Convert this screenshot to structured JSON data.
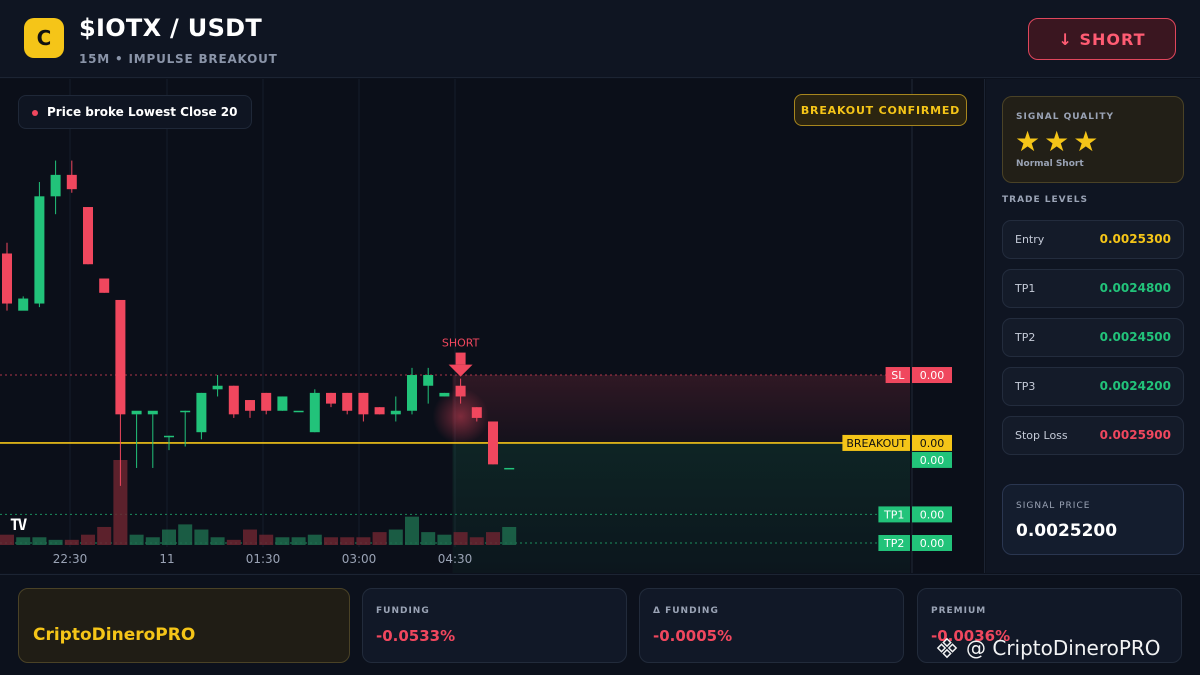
{
  "header": {
    "logo_letter": "C",
    "title": "$IOTX / USDT",
    "subtitle": "15M • IMPULSE BREAKOUT",
    "action_label": "↓ SHORT"
  },
  "chart": {
    "info_text": "Price broke Lowest Close 20",
    "confirm_badge": "BREAKOUT CONFIRMED",
    "signal_marker": "SHORT",
    "watermark_logo": "TV",
    "time_labels": [
      "22:30",
      "11",
      "01:30",
      "03:00",
      "04:30"
    ],
    "price_tags": [
      {
        "label": "SL",
        "value": "0.00",
        "color": "#f0475e"
      },
      {
        "label": "BREAKOUT",
        "value": "0.00",
        "color": "#f5c518"
      },
      {
        "label": "",
        "value": "0.00",
        "color": "#22c37a"
      },
      {
        "label": "TP1",
        "value": "0.00",
        "color": "#22c37a"
      },
      {
        "label": "TP2",
        "value": "0.00",
        "color": "#22c37a"
      }
    ],
    "colors": {
      "up": "#22c37a",
      "down": "#f0475e",
      "breakout": "#f5c518"
    }
  },
  "chart_data": {
    "type": "candlestick",
    "candles": [
      {
        "o": 0.0025335,
        "h": 0.002535,
        "l": 0.0025255,
        "c": 0.0025265
      },
      {
        "o": 0.0025255,
        "h": 0.0025275,
        "l": 0.0025265,
        "c": 0.0025272
      },
      {
        "o": 0.0025265,
        "h": 0.0025435,
        "l": 0.002526,
        "c": 0.0025415
      },
      {
        "o": 0.0025415,
        "h": 0.0025465,
        "l": 0.002539,
        "c": 0.0025445
      },
      {
        "o": 0.0025445,
        "h": 0.0025465,
        "l": 0.002542,
        "c": 0.0025425
      },
      {
        "o": 0.00254,
        "h": 0.00254,
        "l": 0.002532,
        "c": 0.002532
      },
      {
        "o": 0.00253,
        "h": 0.00253,
        "l": 0.002528,
        "c": 0.002528
      },
      {
        "o": 0.002527,
        "h": 0.002527,
        "l": 0.002501,
        "c": 0.002511
      },
      {
        "o": 0.002511,
        "h": 0.002511,
        "l": 0.0025035,
        "c": 0.0025115
      },
      {
        "o": 0.002511,
        "h": 0.002511,
        "l": 0.0025035,
        "c": 0.0025115
      },
      {
        "o": 0.002508,
        "h": 0.002508,
        "l": 0.002506,
        "c": 0.002508
      },
      {
        "o": 0.0025115,
        "h": 0.0025115,
        "l": 0.0025065,
        "c": 0.0025115
      },
      {
        "o": 0.0025085,
        "h": 0.002514,
        "l": 0.0025075,
        "c": 0.002514
      },
      {
        "o": 0.0025145,
        "h": 0.0025165,
        "l": 0.0025135,
        "c": 0.002515
      },
      {
        "o": 0.002515,
        "h": 0.002515,
        "l": 0.0025105,
        "c": 0.002511
      },
      {
        "o": 0.002513,
        "h": 0.002513,
        "l": 0.0025105,
        "c": 0.0025115
      },
      {
        "o": 0.002514,
        "h": 0.002514,
        "l": 0.002511,
        "c": 0.0025115
      },
      {
        "o": 0.0025115,
        "h": 0.0025135,
        "l": 0.0025115,
        "c": 0.0025135
      },
      {
        "o": 0.0025115,
        "h": 0.0025115,
        "l": 0.0025115,
        "c": 0.0025115
      },
      {
        "o": 0.0025085,
        "h": 0.0025145,
        "l": 0.0025085,
        "c": 0.002514
      },
      {
        "o": 0.002514,
        "h": 0.002514,
        "l": 0.002512,
        "c": 0.0025125
      },
      {
        "o": 0.002514,
        "h": 0.002514,
        "l": 0.002511,
        "c": 0.0025115
      },
      {
        "o": 0.002514,
        "h": 0.002514,
        "l": 0.00251,
        "c": 0.002511
      },
      {
        "o": 0.002512,
        "h": 0.002512,
        "l": 0.002511,
        "c": 0.002511
      },
      {
        "o": 0.002511,
        "h": 0.0025135,
        "l": 0.00251,
        "c": 0.0025115
      },
      {
        "o": 0.0025115,
        "h": 0.0025175,
        "l": 0.002511,
        "c": 0.0025165
      },
      {
        "o": 0.002515,
        "h": 0.0025175,
        "l": 0.0025125,
        "c": 0.0025165
      },
      {
        "o": 0.0025135,
        "h": 0.002514,
        "l": 0.0025135,
        "c": 0.002514
      },
      {
        "o": 0.002515,
        "h": 0.002516,
        "l": 0.0025125,
        "c": 0.0025135
      },
      {
        "o": 0.002512,
        "h": 0.002512,
        "l": 0.00251,
        "c": 0.0025105
      },
      {
        "o": 0.00251,
        "h": 0.00251,
        "l": 0.002504,
        "c": 0.002504
      },
      {
        "o": 0.0025035,
        "h": 0.0025035,
        "l": 0.0025035,
        "c": 0.0025035
      }
    ],
    "volumes": [
      0.4,
      0.3,
      0.3,
      0.2,
      0.2,
      0.4,
      0.7,
      3.3,
      0.4,
      0.3,
      0.6,
      0.8,
      0.6,
      0.3,
      0.2,
      0.6,
      0.4,
      0.3,
      0.3,
      0.4,
      0.3,
      0.3,
      0.3,
      0.5,
      0.6,
      1.1,
      0.5,
      0.4,
      0.5,
      0.3,
      0.5,
      0.7
    ],
    "levels": {
      "sl": 0.0025165,
      "breakout": 0.002507,
      "tp1": 0.002497,
      "tp2": 0.002493
    },
    "signal_index": 28
  },
  "sidebar": {
    "quality_label": "SIGNAL QUALITY",
    "stars": "★★★",
    "quality_sub": "Normal Short",
    "levels_title": "TRADE LEVELS",
    "levels": [
      {
        "name": "Entry",
        "value": "0.0025300",
        "color": "#f5c518"
      },
      {
        "name": "TP1",
        "value": "0.0024800",
        "color": "#22c37a"
      },
      {
        "name": "TP2",
        "value": "0.0024500",
        "color": "#22c37a"
      },
      {
        "name": "TP3",
        "value": "0.0024200",
        "color": "#22c37a"
      },
      {
        "name": "Stop Loss",
        "value": "0.0025900",
        "color": "#f0475e"
      }
    ],
    "signal_price_label": "SIGNAL PRICE",
    "signal_price": "0.0025200"
  },
  "footer": {
    "brand": "CriptoDineroPRO",
    "metrics": [
      {
        "label": "FUNDING",
        "value": "-0.0533%"
      },
      {
        "label": "Δ FUNDING",
        "value": "-0.0005%"
      },
      {
        "label": "PREMIUM",
        "value": "-0.0036%"
      }
    ],
    "watermark": "@ CriptoDineroPRO"
  }
}
